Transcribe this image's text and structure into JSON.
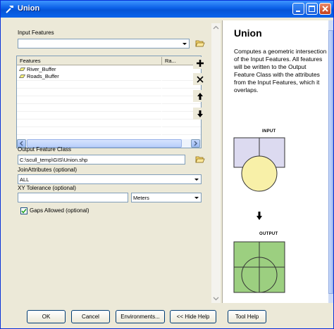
{
  "window": {
    "title": "Union"
  },
  "tool": {
    "input_features_label": "Input Features",
    "input_features_value": "",
    "grid": {
      "header_features": "Features",
      "header_rank": "Ra...",
      "rows": [
        "River_Buffer",
        "Roads_Buffer"
      ]
    },
    "output_label": "Output Feature Class",
    "output_value": "C:\\scull_temp\\GIS\\Union.shp",
    "join_label": "JoinAttributes (optional)",
    "join_value": "ALL",
    "xy_label": "XY Tolerance (optional)",
    "xy_value": "",
    "xy_units": "Meters",
    "gaps_label": "Gaps Allowed (optional)",
    "gaps_checked": true
  },
  "help": {
    "title": "Union",
    "body": "Computes a geometric intersection of the Input Features. All features will be written to the Output Feature Class with the attributes from the Input Features, which it overlaps.",
    "input_caption": "INPUT",
    "output_caption": "OUTPUT"
  },
  "buttons": {
    "ok": "OK",
    "cancel": "Cancel",
    "environments": "Environments...",
    "hide_help": "<< Hide Help",
    "tool_help": "Tool Help"
  },
  "colors": {
    "titlebar": "#0a5fe6",
    "input_square": "#dcdaf0",
    "input_circle": "#f8f0a8",
    "output_fill": "#9ccf80"
  }
}
